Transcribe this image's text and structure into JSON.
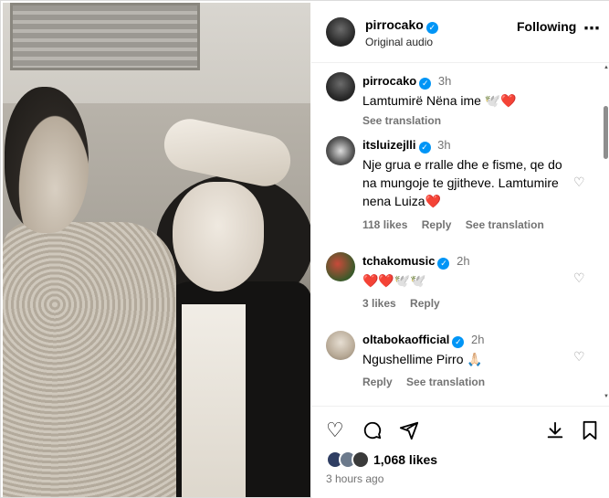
{
  "post": {
    "username": "pirrocako",
    "subtitle": "Original audio",
    "follow_label": "Following",
    "more_icon": "⋯"
  },
  "comments": [
    {
      "username": "pirrocako",
      "verified": true,
      "time": "3h",
      "text": "Lamtumirë Nëna ime 🕊️❤️",
      "meta": [
        "See translation"
      ]
    },
    {
      "username": "itsluizejlli",
      "verified": true,
      "time": "3h",
      "text": "Nje grua e rralle dhe e fisme, qe do na mungoje te gjitheve. Lamtumire nena Luiza❤️",
      "meta": [
        "118 likes",
        "Reply",
        "See translation"
      ]
    },
    {
      "username": "tchakomusic",
      "verified": true,
      "time": "2h",
      "text": "❤️❤️🕊️🕊️",
      "meta": [
        "3 likes",
        "Reply"
      ]
    },
    {
      "username": "oltabokaofficial",
      "verified": true,
      "time": "2h",
      "text": "Ngushellime Pirro 🙏🏻",
      "meta": [
        "Reply",
        "See translation"
      ]
    }
  ],
  "footer": {
    "likes": "1,068 likes",
    "time_ago": "3 hours ago"
  },
  "icons": {
    "like": "♡",
    "comment": "◯",
    "share": "➢",
    "save": "⭳",
    "bookmark": "🔖"
  },
  "colors": {
    "verified": "#0095f6",
    "muted": "#737373"
  }
}
